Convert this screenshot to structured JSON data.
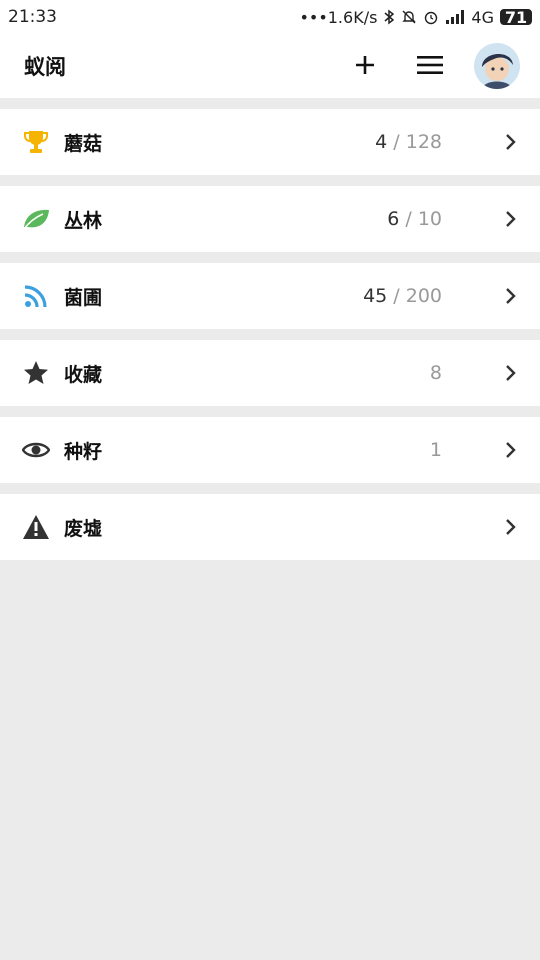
{
  "status_bar": {
    "time": "21:33",
    "net_speed": "•••1.6K/s",
    "network": "4G",
    "battery": "71",
    "icons": [
      "bluetooth-icon",
      "mute-icon",
      "alarm-icon",
      "signal-icon"
    ]
  },
  "header": {
    "title": "蚁阅",
    "add_icon": "plus-icon",
    "menu_icon": "hamburger-icon"
  },
  "colors": {
    "trophy": "#f5b400",
    "leaf": "#5cb85c",
    "rss": "#3aa0e0",
    "dark_icon": "#333333",
    "count_muted": "#999999"
  },
  "items": [
    {
      "label": "蘑菇",
      "icon": "trophy-icon",
      "count": "4",
      "sep": " / ",
      "total": "128"
    },
    {
      "label": "丛林",
      "icon": "leaf-icon",
      "count": "6",
      "sep": " / ",
      "total": "10"
    },
    {
      "label": "菌圃",
      "icon": "rss-icon",
      "count": "45",
      "sep": " / ",
      "total": "200"
    },
    {
      "label": "收藏",
      "icon": "star-icon",
      "count": "8"
    },
    {
      "label": "种籽",
      "icon": "eye-icon",
      "count": "1"
    },
    {
      "label": "废墟",
      "icon": "warning-icon"
    }
  ]
}
